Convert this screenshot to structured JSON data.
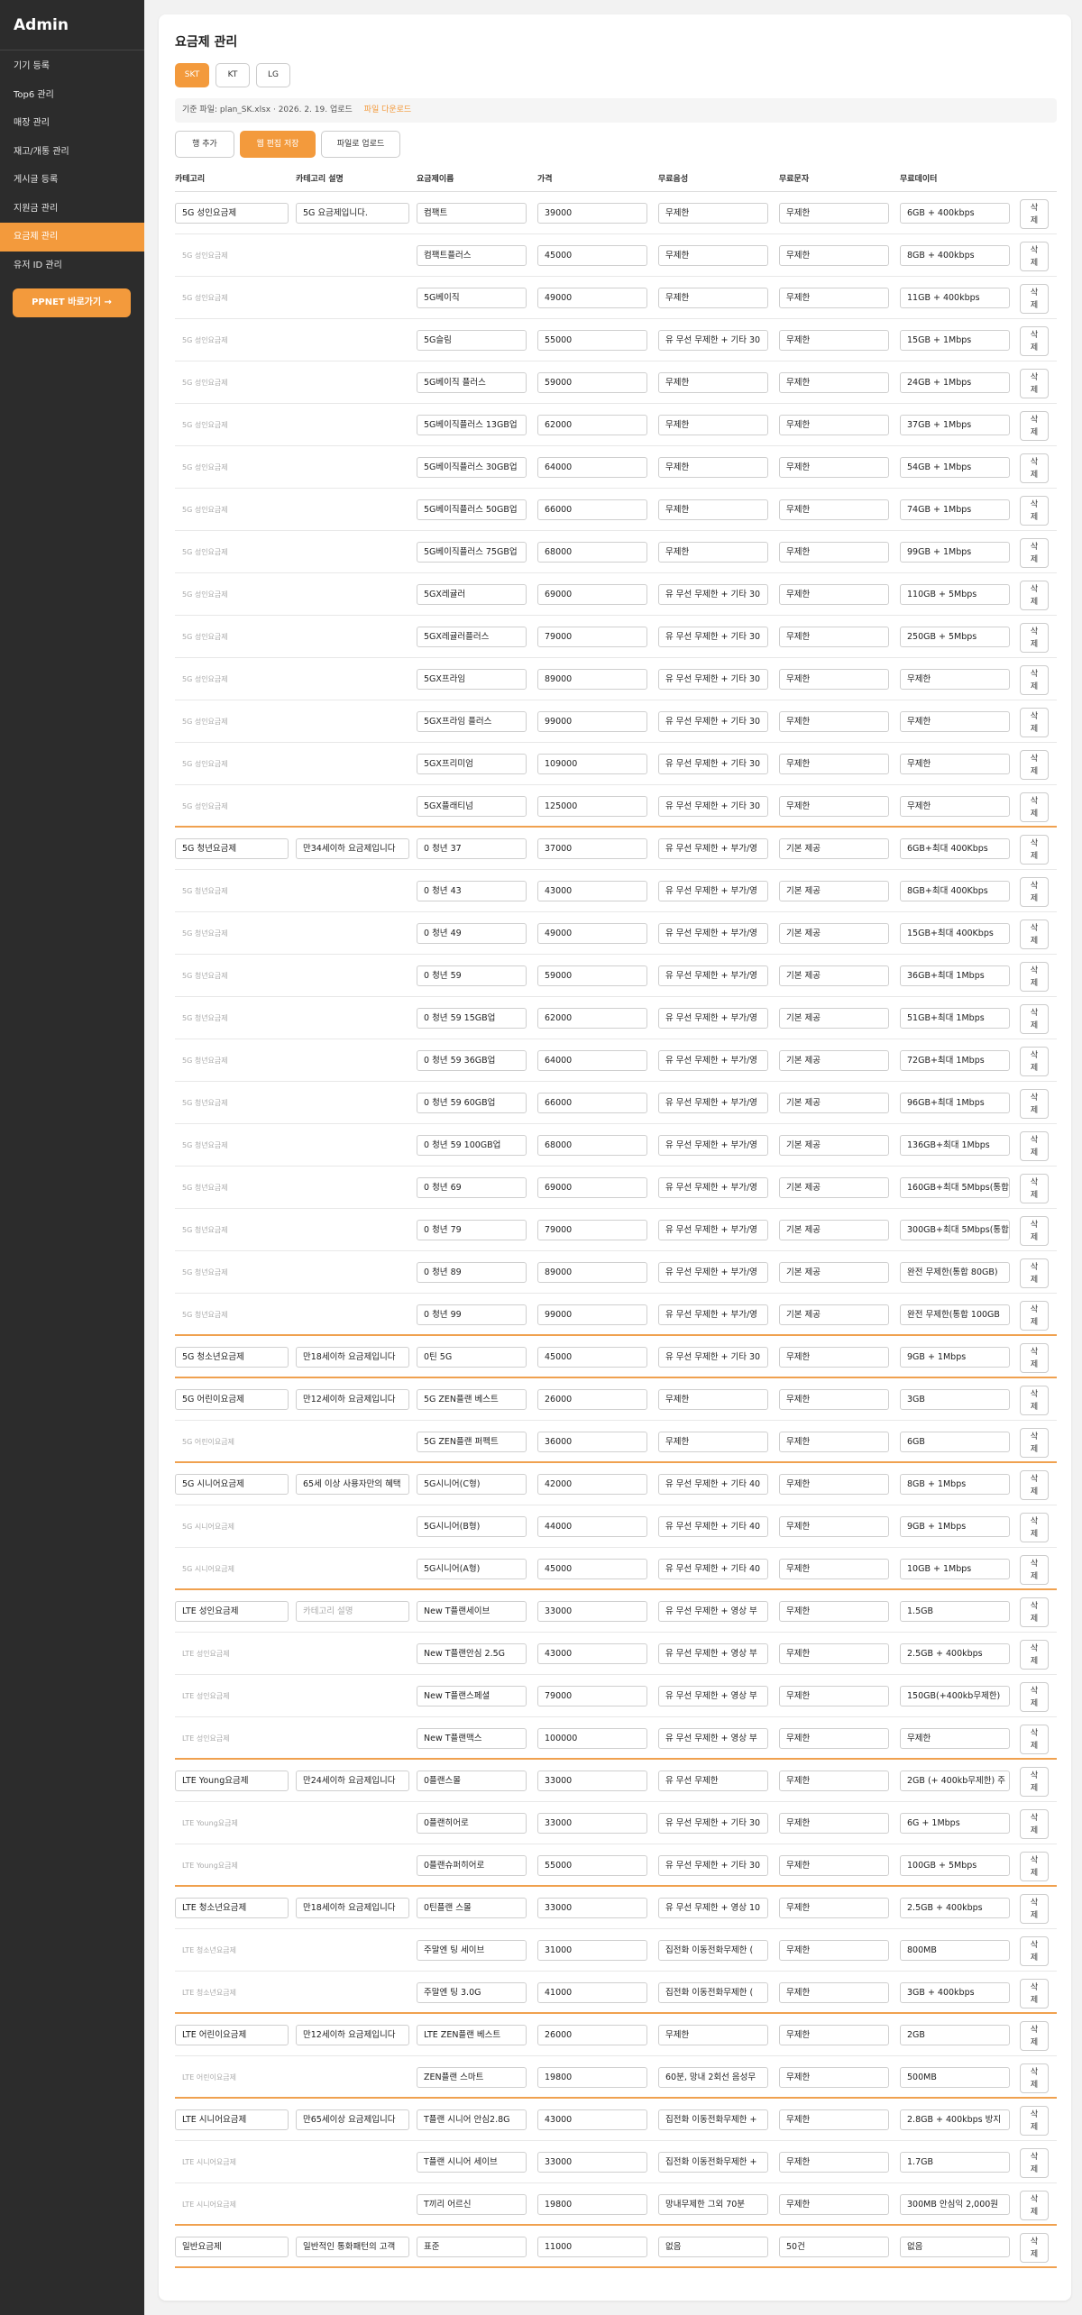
{
  "app": {
    "brand": "Admin"
  },
  "sidebar": {
    "items": [
      "기기 등록",
      "Top6 관리",
      "매장 관리",
      "재고/개통 관리",
      "게시글 등록",
      "지원금 관리",
      "요금제 관리",
      "유저 ID 관리"
    ],
    "active_index": 6,
    "ppnet_label": "PPNET 바로가기 →"
  },
  "page": {
    "title": "요금제 관리"
  },
  "carriers": {
    "tabs": [
      "SKT",
      "KT",
      "LG"
    ],
    "active": "SKT"
  },
  "file": {
    "info": "기준 파일: plan_SK.xlsx · 2026. 2. 19. 업로드",
    "download_label": "파일 다운로드"
  },
  "actions": {
    "add_row": "행 추가",
    "save": "웹 편집 저장",
    "upload": "파일로 업로드"
  },
  "table": {
    "headers": [
      "카테고리",
      "카테고리 설명",
      "요금제이름",
      "가격",
      "무료음성",
      "무료문자",
      "무료데이터"
    ],
    "delete_label": "삭제",
    "desc_placeholder": "카테고리 설명",
    "groups": [
      {
        "category": "5G 성인요금제",
        "description": "5G 요금제입니다.",
        "rows": [
          [
            "컴팩트",
            "39000",
            "무제한",
            "무제한",
            "6GB + 400kbps"
          ],
          [
            "컴팩트플러스",
            "45000",
            "무제한",
            "무제한",
            "8GB + 400kbps"
          ],
          [
            "5G베이직",
            "49000",
            "무제한",
            "무제한",
            "11GB + 400kbps"
          ],
          [
            "5G슬림",
            "55000",
            "유 무선 무제한 + 기타 30",
            "무제한",
            "15GB + 1Mbps"
          ],
          [
            "5G베이직 플러스",
            "59000",
            "무제한",
            "무제한",
            "24GB + 1Mbps"
          ],
          [
            "5G베이직플러스 13GB업",
            "62000",
            "무제한",
            "무제한",
            "37GB + 1Mbps"
          ],
          [
            "5G베이직플러스 30GB업",
            "64000",
            "무제한",
            "무제한",
            "54GB + 1Mbps"
          ],
          [
            "5G베이직플러스 50GB업",
            "66000",
            "무제한",
            "무제한",
            "74GB + 1Mbps"
          ],
          [
            "5G베이직플러스 75GB업",
            "68000",
            "무제한",
            "무제한",
            "99GB + 1Mbps"
          ],
          [
            "5GX레귤러",
            "69000",
            "유 무선 무제한 + 기타 30",
            "무제한",
            "110GB + 5Mbps"
          ],
          [
            "5GX레귤러플러스",
            "79000",
            "유 무선 무제한 + 기타 30",
            "무제한",
            "250GB + 5Mbps"
          ],
          [
            "5GX프라임",
            "89000",
            "유 무선 무제한 + 기타 30",
            "무제한",
            "무제한"
          ],
          [
            "5GX프라임 플러스",
            "99000",
            "유 무선 무제한 + 기타 30",
            "무제한",
            "무제한"
          ],
          [
            "5GX프리미엄",
            "109000",
            "유 무선 무제한 + 기타 30",
            "무제한",
            "무제한"
          ],
          [
            "5GX플래티넘",
            "125000",
            "유 무선 무제한 + 기타 30",
            "무제한",
            "무제한"
          ]
        ]
      },
      {
        "category": "5G 청년요금제",
        "description": "만34세이하 요금제입니다",
        "rows": [
          [
            "0 청년 37",
            "37000",
            "유 무선 무제한 + 부가/영",
            "기본 제공",
            "6GB+최대 400Kbps"
          ],
          [
            "0 청년 43",
            "43000",
            "유 무선 무제한 + 부가/영",
            "기본 제공",
            "8GB+최대 400Kbps"
          ],
          [
            "0 청년 49",
            "49000",
            "유 무선 무제한 + 부가/영",
            "기본 제공",
            "15GB+최대 400Kbps"
          ],
          [
            "0 청년 59",
            "59000",
            "유 무선 무제한 + 부가/영",
            "기본 제공",
            "36GB+최대 1Mbps"
          ],
          [
            "0 청년 59 15GB업",
            "62000",
            "유 무선 무제한 + 부가/영",
            "기본 제공",
            "51GB+최대 1Mbps"
          ],
          [
            "0 청년 59 36GB업",
            "64000",
            "유 무선 무제한 + 부가/영",
            "기본 제공",
            "72GB+최대 1Mbps"
          ],
          [
            "0 청년 59 60GB업",
            "66000",
            "유 무선 무제한 + 부가/영",
            "기본 제공",
            "96GB+최대 1Mbps"
          ],
          [
            "0 청년 59 100GB업",
            "68000",
            "유 무선 무제한 + 부가/영",
            "기본 제공",
            "136GB+최대 1Mbps"
          ],
          [
            "0 청년 69",
            "69000",
            "유 무선 무제한 + 부가/영",
            "기본 제공",
            "160GB+최대 5Mbps(통합"
          ],
          [
            "0 청년 79",
            "79000",
            "유 무선 무제한 + 부가/영",
            "기본 제공",
            "300GB+최대 5Mbps(통합"
          ],
          [
            "0 청년 89",
            "89000",
            "유 무선 무제한 + 부가/영",
            "기본 제공",
            "완전 무제한(통합 80GB)"
          ],
          [
            "0 청년 99",
            "99000",
            "유 무선 무제한 + 부가/영",
            "기본 제공",
            "완전 무제한(통합 100GB"
          ]
        ]
      },
      {
        "category": "5G 청소년요금제",
        "description": "만18세이하 요금제입니다",
        "rows": [
          [
            "0틴 5G",
            "45000",
            "유 무선 무제한 + 기타 30",
            "무제한",
            "9GB + 1Mbps"
          ]
        ]
      },
      {
        "category": "5G 어린이요금제",
        "description": "만12세이하 요금제입니다",
        "rows": [
          [
            "5G ZEN플랜 베스트",
            "26000",
            "무제한",
            "무제한",
            "3GB"
          ],
          [
            "5G ZEN플랜 퍼펙트",
            "36000",
            "무제한",
            "무제한",
            "6GB"
          ]
        ]
      },
      {
        "category": "5G 시니어요금제",
        "description": "65세 이상 사용자만의 혜택",
        "rows": [
          [
            "5G시니어(C형)",
            "42000",
            "유 무선 무제한 + 기타 40",
            "무제한",
            "8GB + 1Mbps"
          ],
          [
            "5G시니어(B형)",
            "44000",
            "유 무선 무제한 + 기타 40",
            "무제한",
            "9GB + 1Mbps"
          ],
          [
            "5G시니어(A형)",
            "45000",
            "유 무선 무제한 + 기타 40",
            "무제한",
            "10GB + 1Mbps"
          ]
        ]
      },
      {
        "category": "LTE 성인요금제",
        "description": "",
        "rows": [
          [
            "New T플랜세이브",
            "33000",
            "유 무선 무제한 + 영상 부",
            "무제한",
            "1.5GB"
          ],
          [
            "New T플랜안심 2.5G",
            "43000",
            "유 무선 무제한 + 영상 부",
            "무제한",
            "2.5GB + 400kbps"
          ],
          [
            "New T플랜스페셜",
            "79000",
            "유 무선 무제한 + 영상 부",
            "무제한",
            "150GB(+400kb무제한)"
          ],
          [
            "New T플랜맥스",
            "100000",
            "유 무선 무제한 + 영상 부",
            "무제한",
            "무제한"
          ]
        ]
      },
      {
        "category": "LTE Young요금제",
        "description": "만24세이하 요금제입니다",
        "rows": [
          [
            "0플랜스몰",
            "33000",
            "유 무선 무제한",
            "무제한",
            "2GB (+ 400kb무제한) 주"
          ],
          [
            "0플랜히어로",
            "33000",
            "유 무선 무제한 + 기타 30",
            "무제한",
            "6G + 1Mbps"
          ],
          [
            "0플랜슈퍼히어로",
            "55000",
            "유 무선 무제한 + 기타 30",
            "무제한",
            "100GB + 5Mbps"
          ]
        ]
      },
      {
        "category": "LTE 청소년요금제",
        "description": "만18세이하 요금제입니다",
        "rows": [
          [
            "0틴플랜 스몰",
            "33000",
            "유 무선 무제한 + 영상 10",
            "무제한",
            "2.5GB + 400kbps"
          ],
          [
            "주말엔 팅 세이브",
            "31000",
            "집전화 이동전화무제한 (",
            "무제한",
            "800MB"
          ],
          [
            "주말엔 팅 3.0G",
            "41000",
            "집전화 이동전화무제한 (",
            "무제한",
            "3GB + 400kbps"
          ]
        ]
      },
      {
        "category": "LTE 어린이요금제",
        "description": "만12세이하 요금제입니다",
        "rows": [
          [
            "LTE ZEN플랜 베스트",
            "26000",
            "무제한",
            "무제한",
            "2GB"
          ],
          [
            "ZEN플랜 스마트",
            "19800",
            "60분, 망내 2회선 음성무",
            "무제한",
            "500MB"
          ]
        ]
      },
      {
        "category": "LTE 시니어요금제",
        "description": "만65세이상 요금제입니다",
        "rows": [
          [
            "T플랜 시니어 안심2.8G",
            "43000",
            "집전화 이동전화무제한 +",
            "무제한",
            "2.8GB + 400kbps 방지"
          ],
          [
            "T플랜 시니어 세이브",
            "33000",
            "집전화 이동전화무제한 +",
            "무제한",
            "1.7GB"
          ],
          [
            "T끼리 어르신",
            "19800",
            "망내무제한 그외 70분",
            "무제한",
            "300MB 안심익 2,000원"
          ]
        ]
      },
      {
        "category": "일반요금제",
        "description": "일반적인 통화패턴의 고객",
        "rows": [
          [
            "표준",
            "11000",
            "없음",
            "50건",
            "없음"
          ]
        ]
      }
    ]
  }
}
